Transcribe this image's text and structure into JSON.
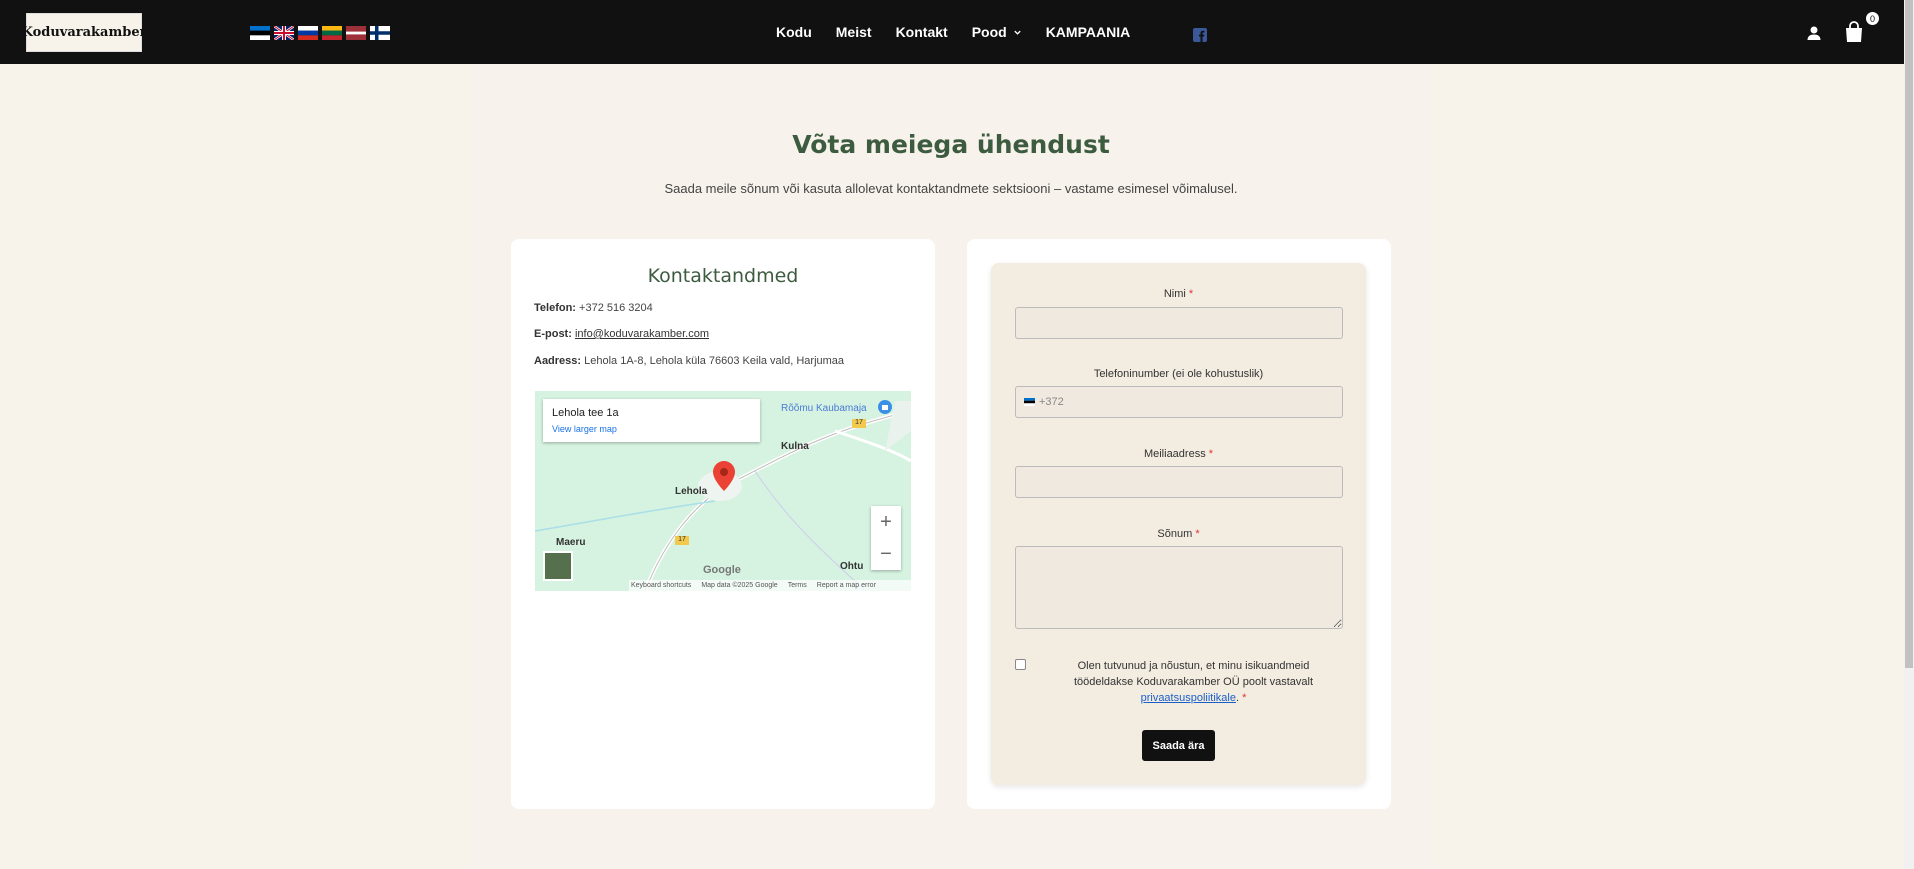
{
  "header": {
    "logo_text": "Koduvarakamber",
    "flags": [
      "estonia-flag",
      "uk-flag",
      "russia-flag",
      "lithuania-flag",
      "latvia-flag",
      "finland-flag"
    ],
    "nav": [
      {
        "label": "Kodu"
      },
      {
        "label": "Meist"
      },
      {
        "label": "Kontakt"
      },
      {
        "label": "Pood"
      },
      {
        "label": "KAMPAANIA"
      }
    ],
    "cart_count": "0"
  },
  "page": {
    "title": "Võta meiega ühendust",
    "subtitle": "Saada meile sõnum või kasuta allolevat kontaktandmete sektsiooni – vastame esimesel võimalusel."
  },
  "contact": {
    "heading": "Kontaktandmed",
    "phone_label": "Telefon:",
    "phone_value": "+372 516 3204",
    "email_label": "E-post:",
    "email_value": "info@koduvarakamber.com",
    "address_label": "Aadress:",
    "address_value": "Lehola 1A-8, Lehola küla 76603 Keila vald, Harjumaa"
  },
  "map": {
    "place": "Lehola tee 1a",
    "larger_map": "View larger map",
    "labels": [
      "Rõõmu Kaubamaja",
      "Kulna",
      "Lehola",
      "Maeru",
      "Ohtu"
    ],
    "road_badge": "17",
    "google": "Google",
    "footer": [
      "Keyboard shortcuts",
      "Map data ©2025 Google",
      "Terms",
      "Report a map error"
    ]
  },
  "form": {
    "name_label": "Nimi",
    "phone_label": "Telefoninumber (ei ole kohustuslik)",
    "phone_prefix": "+372",
    "email_label": "Meiliaadress",
    "message_label": "Sõnum",
    "required_mark": "*",
    "consent_text": "Olen tutvunud ja nõustun, et minu isikuandmeid töödeldakse Koduvarakamber OÜ poolt vastavalt",
    "consent_link": "privaatsuspoliitikale",
    "consent_end": ".",
    "submit_label": "Saada ära"
  },
  "colors": {
    "header_bg": "#111111",
    "accent_green": "#3d5b3f",
    "page_bg": "#f7f2ea",
    "form_bg": "#f3ece1",
    "link_blue": "#1a5fc9"
  }
}
